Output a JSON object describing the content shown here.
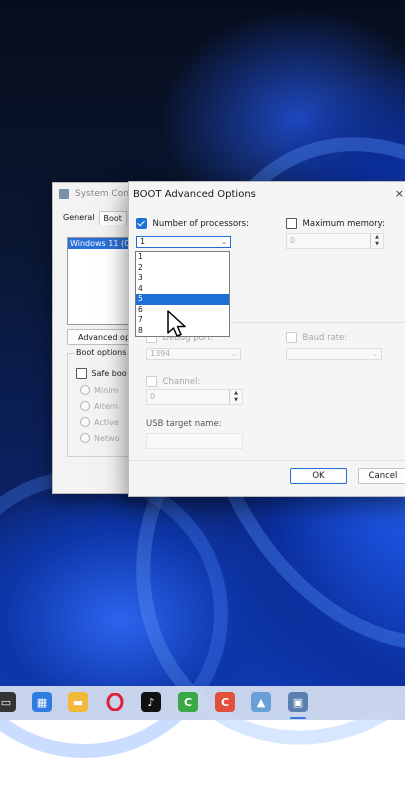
{
  "system_config": {
    "title": "System Con",
    "tabs": [
      "General",
      "Boot"
    ],
    "os_list_item": "Windows 11 (C",
    "advanced_button": "Advanced op",
    "boot_options_legend": "Boot options",
    "safe_boot_label": "Safe boo",
    "radio_options": [
      "Minim",
      "Altern",
      "Active",
      "Netwo"
    ]
  },
  "dialog": {
    "title": "BOOT Advanced Options",
    "close_glyph": "×",
    "num_processors_label": "Number of processors:",
    "num_processors_value": "1",
    "processor_options": [
      "1",
      "2",
      "3",
      "4",
      "5",
      "6",
      "7",
      "8"
    ],
    "highlighted_option": "5",
    "max_memory_label": "Maximum memory:",
    "max_memory_value": "0",
    "debug_port_label": "Debug port:",
    "debug_port_value": "1394",
    "baud_rate_label": "Baud rate:",
    "channel_label": "Channel:",
    "channel_value": "0",
    "usb_target_label": "USB target name:",
    "ok_label": "OK",
    "cancel_label": "Cancel"
  },
  "colors": {
    "accent": "#1f6fd8",
    "desktop": "#0b2266"
  },
  "taskbar": {
    "icons": [
      "terminal-icon",
      "store-icon",
      "file-explorer-icon",
      "opera-icon",
      "tiktok-icon",
      "camtasia-icon",
      "camtasia-recorder-icon",
      "photos-icon",
      "system-configuration-icon"
    ]
  }
}
